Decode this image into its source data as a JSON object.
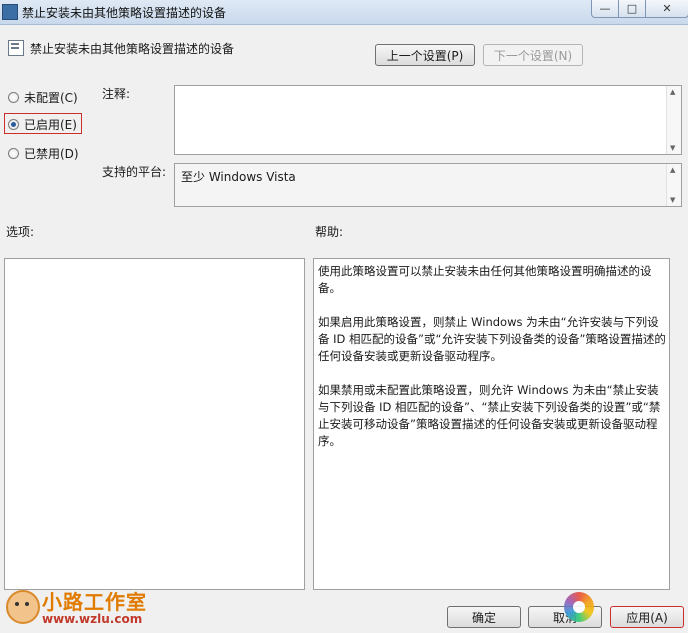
{
  "window": {
    "title": "禁止安装未由其他策略设置描述的设备",
    "controls": {
      "minimize": "—",
      "maximize": "□",
      "close": "✕"
    }
  },
  "header": {
    "title": "禁止安装未由其他策略设置描述的设备",
    "prev_button": "上一个设置(P)",
    "next_button": "下一个设置(N)"
  },
  "state": {
    "not_configured": "未配置(C)",
    "enabled": "已启用(E)",
    "disabled": "已禁用(D)",
    "selected": "enabled"
  },
  "labels": {
    "comment": "注释:",
    "supported_on": "支持的平台:",
    "options": "选项:",
    "help": "帮助:"
  },
  "supported_on_value": "至少 Windows Vista",
  "comment_value": "",
  "help_paragraphs": [
    "使用此策略设置可以禁止安装未由任何其他策略设置明确描述的设备。",
    "如果启用此策略设置，则禁止 Windows 为未由“允许安装与下列设备 ID 相匹配的设备”或“允许安装下列设备类的设备”策略设置描述的任何设备安装或更新设备驱动程序。",
    "如果禁用或未配置此策略设置，则允许 Windows 为未由“禁止安装与下列设备 ID 相匹配的设备”、“禁止安装下列设备类的设置”或“禁止安装可移动设备”策略设置描述的任何设备安装或更新设备驱动程序。"
  ],
  "footer": {
    "ok": "确定",
    "cancel": "取消",
    "apply": "应用(A)"
  },
  "watermark": {
    "logo_text": "小路工作室",
    "logo_url": "www.wzlu.com"
  }
}
